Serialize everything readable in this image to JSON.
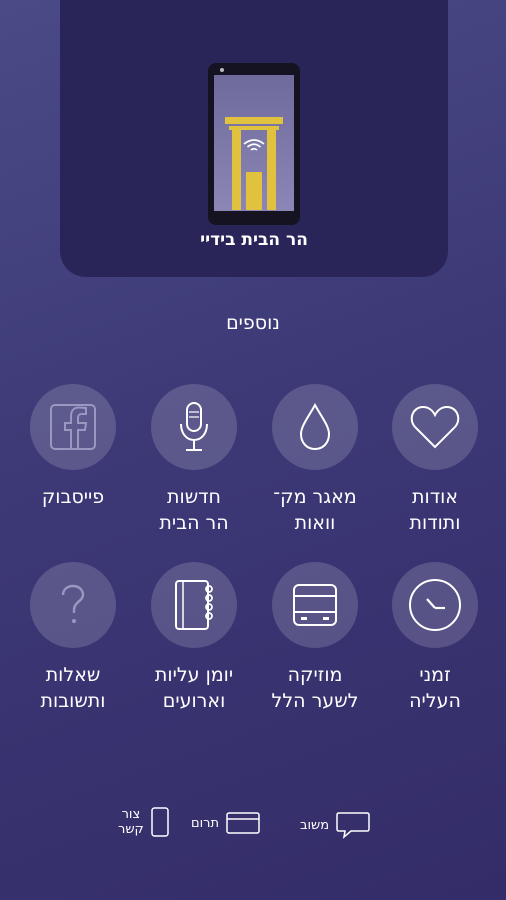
{
  "header": {
    "app_title": "הר הבית בידיי"
  },
  "section_title": "נוספים",
  "tiles": [
    {
      "label": "אודות\nותודות",
      "icon": "heart-icon"
    },
    {
      "label": "מאגר מק־\nוואות",
      "icon": "water-drop-icon"
    },
    {
      "label": "חדשות\nהר הבית",
      "icon": "microphone-icon"
    },
    {
      "label": "פייסבוק",
      "icon": "facebook-icon"
    },
    {
      "label": "זמני\nהעליה",
      "icon": "clock-icon"
    },
    {
      "label": "מוזיקה\nלשער הלל",
      "icon": "bus-icon"
    },
    {
      "label": "יומן עליות\nוארועים",
      "icon": "notebook-icon"
    },
    {
      "label": "שאלות\nותשובות",
      "icon": "question-icon"
    }
  ],
  "bottom_bar": {
    "feedback": "משוב",
    "donate": "תרום",
    "contact": "צור\nקשר"
  },
  "colors": {
    "accent_gold": "#e0c23e",
    "card_bg": "#2a2559"
  }
}
